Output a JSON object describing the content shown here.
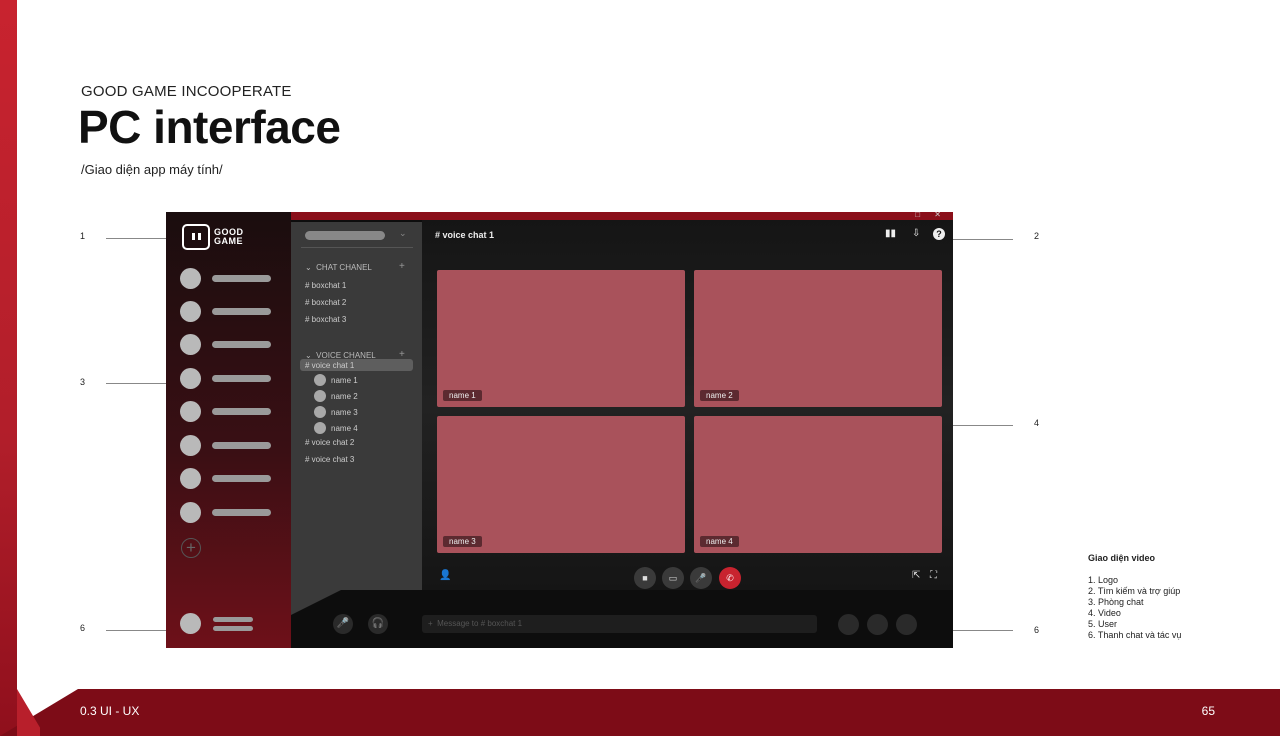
{
  "slide": {
    "eyebrow": "GOOD GAME INCOOPERATE",
    "title": "PC interface",
    "subtitle": "/Giao diện app máy tính/",
    "footer_left": "0.3 UI - UX",
    "page_number": "65",
    "accent_color": "#c8232f",
    "footer_color": "#7d0c17"
  },
  "annotations": {
    "left": [
      "1",
      "3",
      "6"
    ],
    "right": [
      "2",
      "4",
      "6"
    ]
  },
  "legend": {
    "title": "Giao diện video",
    "items": [
      "1. Logo",
      "2. Tìm kiếm và trợ giúp",
      "3. Phòng chat",
      "4. Video",
      "5. User",
      "6. Thanh chat và tác vụ"
    ]
  },
  "app": {
    "logo_text_1": "GOOD",
    "logo_text_2": "GAME",
    "server_count": 8,
    "add_server_icon": "+",
    "channel_sidebar": {
      "chat_section": "CHAT CHANEL",
      "chat_channels": [
        "# boxchat 1",
        "# boxchat 2",
        "# boxchat 3"
      ],
      "voice_section": "VOICE CHANEL",
      "voice_channels": [
        "# voice chat 1",
        "# voice chat 2",
        "# voice chat 3"
      ],
      "active_voice_members": [
        "name 1",
        "name 2",
        "name 3",
        "name 4"
      ]
    },
    "main": {
      "channel_title": "# voice chat 1",
      "tiles": [
        "name 1",
        "name 2",
        "name 3",
        "name 4"
      ],
      "tile_color": "#a9525b"
    },
    "message_placeholder": "Message to # boxchat 1",
    "message_plus": "+",
    "icons": {
      "layout": "▮▮",
      "inbox": "⇩",
      "help": "?",
      "add_user": "👤",
      "camera": "■",
      "screen": "▭",
      "mic": "🎤",
      "hangup": "✆",
      "popout": "⇱",
      "fullscreen": "⛶",
      "bottom_mic": "🎤",
      "headset": "🎧",
      "chevron": "⌄",
      "plus": "+"
    }
  }
}
